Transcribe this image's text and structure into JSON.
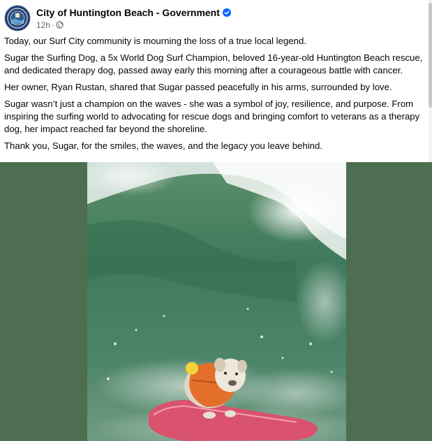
{
  "post": {
    "page_name": "City of Huntington Beach - Government",
    "timestamp": "12h",
    "separator": "·",
    "paragraphs": [
      "Today, our Surf City community is mourning the loss of a true local legend.",
      "Sugar the Surfing Dog, a 5x World Dog Surf Champion, beloved 16-year-old Huntington Beach rescue, and dedicated therapy dog, passed away early this morning after a courageous battle with cancer.",
      "Her owner, Ryan Rustan, shared that Sugar passed peacefully in his arms, surrounded by love.",
      "Sugar wasn’t just a champion on the waves - she was a symbol of joy, resilience, and purpose. From inspiring the surfing world to advocating for rescue dogs and bringing comfort to veterans as a therapy dog, her impact reached far beyond the shoreline.",
      "Thank you, Sugar, for the smiles, the waves, and the legacy you leave behind."
    ]
  },
  "colors": {
    "verified": "#0866ff",
    "media_background": "#4d6e50",
    "meta_text": "#65676b"
  },
  "icons": {
    "verified": "verified-badge-icon",
    "audience": "globe-icon"
  }
}
